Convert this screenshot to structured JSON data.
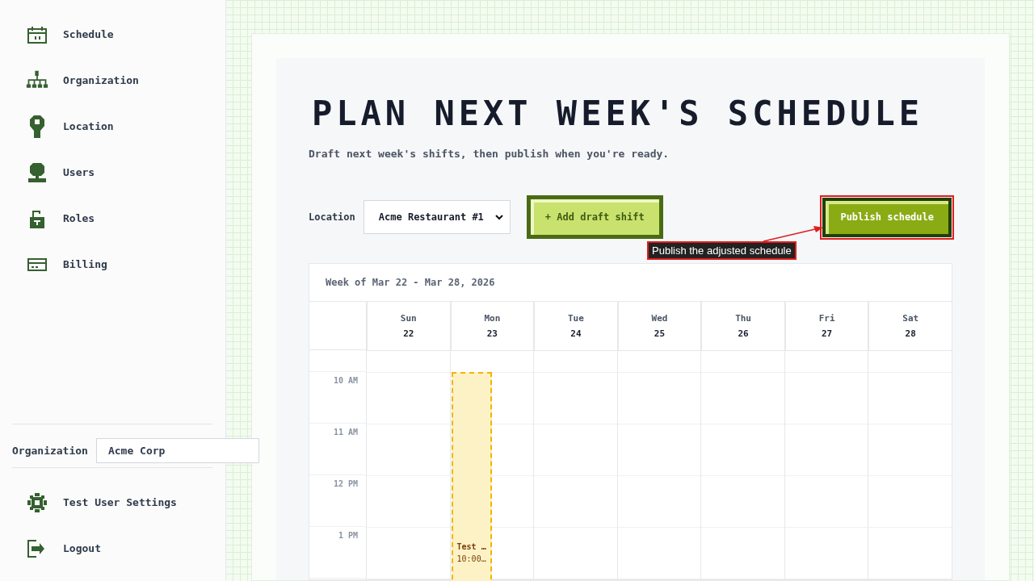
{
  "sidebar": {
    "nav": [
      {
        "label": "Schedule"
      },
      {
        "label": "Organization"
      },
      {
        "label": "Location"
      },
      {
        "label": "Users"
      },
      {
        "label": "Roles"
      },
      {
        "label": "Billing"
      }
    ],
    "organization": {
      "label": "Organization",
      "value": "Acme Corp"
    },
    "footer": [
      {
        "label": "Test User Settings"
      },
      {
        "label": "Logout"
      }
    ]
  },
  "page": {
    "title": "PLAN NEXT WEEK'S SCHEDULE",
    "subtitle": "Draft next week's shifts, then publish when you're ready.",
    "location": {
      "label": "Location",
      "value": "Acme Restaurant #1"
    },
    "add_button": "+ Add draft shift",
    "publish_button": "Publish schedule",
    "annotation": {
      "text": "Publish the adjusted schedule"
    }
  },
  "calendar": {
    "week_label": "Week of Mar 22 - Mar 28, 2026",
    "days": [
      {
        "name": "Sun",
        "date": "22"
      },
      {
        "name": "Mon",
        "date": "23",
        "shifts": [
          {
            "title": "Test …",
            "time": "10:00…"
          }
        ]
      },
      {
        "name": "Tue",
        "date": "24"
      },
      {
        "name": "Wed",
        "date": "25"
      },
      {
        "name": "Thu",
        "date": "26"
      },
      {
        "name": "Fri",
        "date": "27"
      },
      {
        "name": "Sat",
        "date": "28"
      }
    ],
    "hours": [
      "10 AM",
      "11 AM",
      "12 PM",
      "1 PM"
    ]
  }
}
